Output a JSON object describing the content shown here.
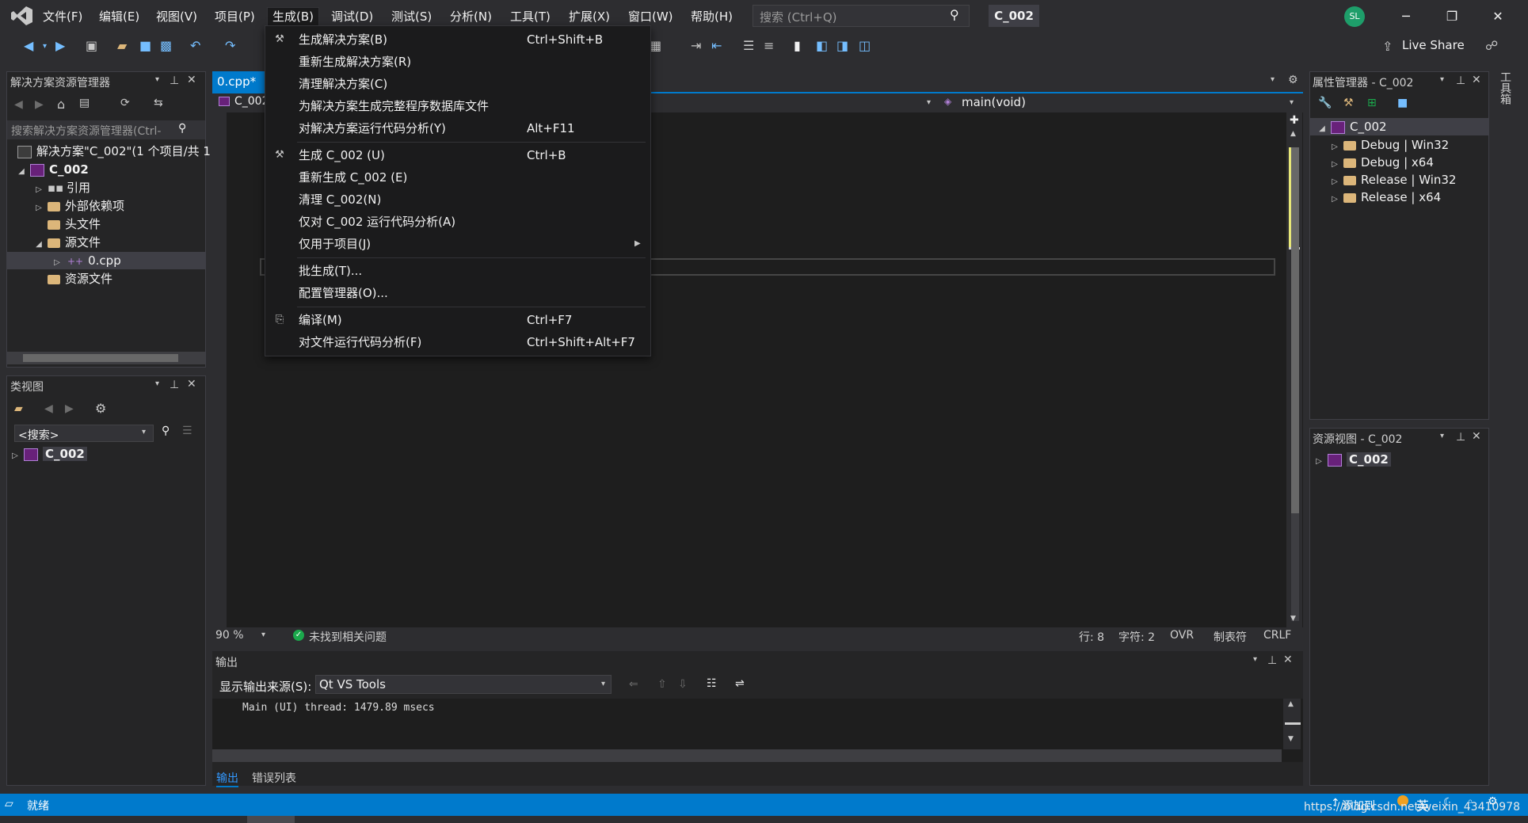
{
  "menu": {
    "items": [
      "文件(F)",
      "编辑(E)",
      "视图(V)",
      "项目(P)",
      "生成(B)",
      "调试(D)",
      "测试(S)",
      "分析(N)",
      "工具(T)",
      "扩展(X)",
      "窗口(W)",
      "帮助(H)"
    ],
    "active": "生成(B)"
  },
  "search": {
    "placeholder": "搜索 (Ctrl+Q)"
  },
  "solution_badge": "C_002",
  "user_initials": "SL",
  "live_share": "Live Share",
  "build_menu": [
    {
      "label": "生成解决方案(B)",
      "shortcut": "Ctrl+Shift+B",
      "icon": "build-icon"
    },
    {
      "label": "重新生成解决方案(R)",
      "shortcut": ""
    },
    {
      "label": "清理解决方案(C)",
      "shortcut": ""
    },
    {
      "label": "为解决方案生成完整程序数据库文件",
      "shortcut": ""
    },
    {
      "label": "对解决方案运行代码分析(Y)",
      "shortcut": "Alt+F11"
    },
    {
      "label": "生成 C_002 (U)",
      "shortcut": "Ctrl+B",
      "icon": "build-icon"
    },
    {
      "label": "重新生成 C_002 (E)",
      "shortcut": ""
    },
    {
      "label": "清理 C_002(N)",
      "shortcut": ""
    },
    {
      "label": "仅对 C_002 运行代码分析(A)",
      "shortcut": ""
    },
    {
      "label": "仅用于项目(J)",
      "shortcut": "",
      "submenu": true
    },
    {
      "label": "批生成(T)...",
      "shortcut": ""
    },
    {
      "label": "配置管理器(O)...",
      "shortcut": ""
    },
    {
      "label": "编译(M)",
      "shortcut": "Ctrl+F7",
      "icon": "compile-icon"
    },
    {
      "label": "对文件运行代码分析(F)",
      "shortcut": "Ctrl+Shift+Alt+F7"
    }
  ],
  "solution_explorer": {
    "title": "解决方案资源管理器",
    "search_placeholder": "搜索解决方案资源管理器(Ctrl-",
    "solution_label": "解决方案\"C_002\"(1 个项目/共 1",
    "project": "C_002",
    "nodes": [
      "引用",
      "外部依赖项",
      "头文件",
      "源文件",
      "0.cpp",
      "资源文件"
    ]
  },
  "class_view": {
    "title": "类视图",
    "search": "<搜索>",
    "project": "C_002"
  },
  "editor": {
    "tab": "0.cpp*",
    "nav_project": "C_002",
    "nav_function": "main(void)",
    "zoom": "90 %",
    "issues": "未找到相关问题",
    "line": "行: 8",
    "char": "字符: 2",
    "ovr": "OVR",
    "tabs": "制表符",
    "eol": "CRLF"
  },
  "output": {
    "title": "输出",
    "source_label": "显示输出来源(S):",
    "source_value": "Qt VS Tools",
    "text": "Main (UI) thread: 1479.89 msecs",
    "tab_output": "输出",
    "tab_errors": "错误列表"
  },
  "property_manager": {
    "title": "属性管理器 - C_002",
    "project": "C_002",
    "configs": [
      "Debug | Win32",
      "Debug | x64",
      "Release | Win32",
      "Release | x64"
    ]
  },
  "resource_view": {
    "title": "资源视图 - C_002",
    "project": "C_002"
  },
  "toolbox_label": "工具箱",
  "status": {
    "ready": "就绪",
    "add_source": "添加到",
    "ime": "英",
    "watermark": "https://blog.csdn.net/weixin_43410978"
  },
  "colors": {
    "accent": "#007acc",
    "background": "#2d2d30",
    "editor": "#1e1e1e"
  }
}
